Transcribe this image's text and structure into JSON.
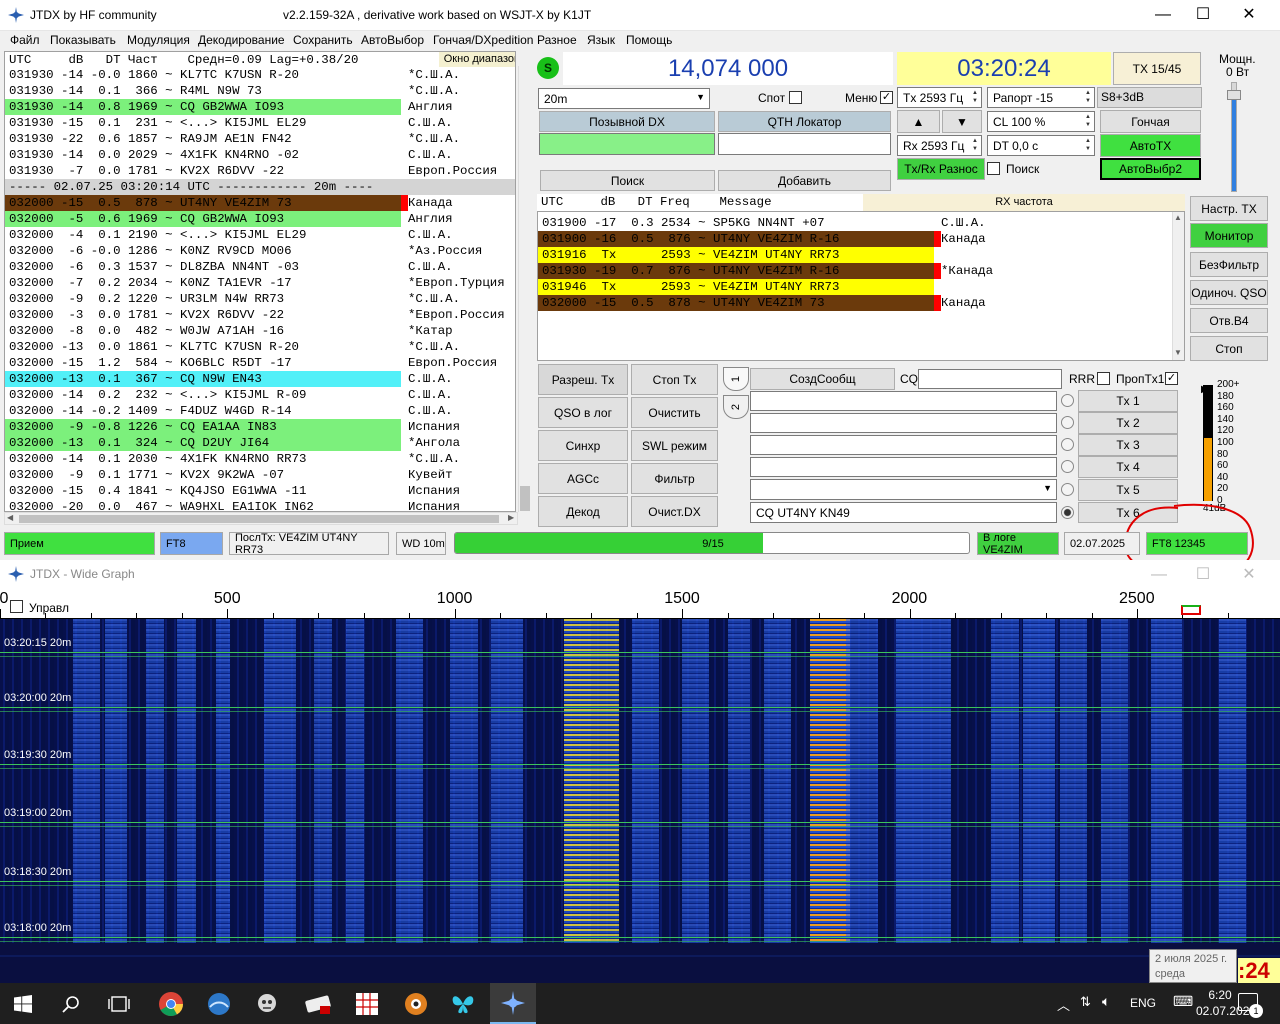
{
  "window": {
    "app_title": "JTDX  by HF community",
    "version_title": "v2.2.159-32A , derivative work based on WSJT-X by K1JT",
    "minimize": "—",
    "maximize": "☐",
    "close": "✕"
  },
  "menu": [
    "Файл",
    "Показывать",
    "Модуляция",
    "Декодирование",
    "Сохранить",
    "АвтоВыбор",
    "Гончая/DXpedition",
    "Разное",
    "Язык",
    "Помощь"
  ],
  "band_activity": {
    "header": "UTC     dB   DT Част    Средн=0.09 Lag=+0.38/20",
    "window_label": "Окно диапазона",
    "lines": [
      {
        "msg": "031930 -14 -0.0 1860 ~ KL7TC K7USN R-20",
        "country": "*С.Ш.А.",
        "style": "none"
      },
      {
        "msg": "031930 -14  0.1  366 ~ R4ML N9W 73",
        "country": "*С.Ш.А.",
        "style": "none"
      },
      {
        "msg": "031930 -14  0.8 1969 ~ CQ GB2WWA IO93",
        "country": "Англия",
        "style": "green"
      },
      {
        "msg": "031930 -15  0.1  231 ~ <...> KI5JML EL29",
        "country": "С.Ш.А.",
        "style": "none"
      },
      {
        "msg": "031930 -22  0.6 1857 ~ RA9JM AE1N FN42",
        "country": "*С.Ш.А.",
        "style": "none"
      },
      {
        "msg": "031930 -14  0.0 2029 ~ 4X1FK KN4RNO -02",
        "country": "С.Ш.А.",
        "style": "none"
      },
      {
        "msg": "031930  -7  0.0 1781 ~ KV2X R6DVV -22",
        "country": "Европ.Россия",
        "style": "none"
      },
      {
        "msg": "----- 02.07.25 03:20:14 UTC ------------ 20m ----",
        "country": "",
        "style": "sep"
      },
      {
        "msg": "032000 -15  0.5  878 ~ UT4NY VE4ZIM 73",
        "country": "Канада",
        "style": "brown"
      },
      {
        "msg": "032000  -5  0.6 1969 ~ CQ GB2WWA IO93",
        "country": "Англия",
        "style": "green"
      },
      {
        "msg": "032000  -4  0.1 2190 ~ <...> KI5JML EL29",
        "country": "С.Ш.А.",
        "style": "none"
      },
      {
        "msg": "032000  -6 -0.0 1286 ~ K0NZ RV9CD MO06",
        "country": "*Аз.Россия",
        "style": "none"
      },
      {
        "msg": "032000  -6  0.3 1537 ~ DL8ZBA NN4NT -03",
        "country": "С.Ш.А.",
        "style": "none"
      },
      {
        "msg": "032000  -7  0.2 2034 ~ K0NZ TA1EVR -17",
        "country": "*Европ.Турция",
        "style": "none"
      },
      {
        "msg": "032000  -9  0.2 1220 ~ UR3LM N4W RR73",
        "country": "*С.Ш.А.",
        "style": "none"
      },
      {
        "msg": "032000  -3  0.0 1781 ~ KV2X R6DVV -22",
        "country": "*Европ.Россия",
        "style": "none"
      },
      {
        "msg": "032000  -8  0.0  482 ~ W0JW A71AH -16",
        "country": "*Катар",
        "style": "none"
      },
      {
        "msg": "032000 -13  0.0 1861 ~ KL7TC K7USN R-20",
        "country": "*С.Ш.А.",
        "style": "none"
      },
      {
        "msg": "032000 -15  1.2  584 ~ KO6BLC R5DT -17",
        "country": "Европ.Россия",
        "style": "none"
      },
      {
        "msg": "032000 -13  0.1  367 ~ CQ N9W EN43",
        "country": "С.Ш.А.",
        "style": "cyan"
      },
      {
        "msg": "032000 -14  0.2  232 ~ <...> KI5JML R-09",
        "country": "С.Ш.А.",
        "style": "none"
      },
      {
        "msg": "032000 -14 -0.2 1409 ~ F4DUZ W4GD R-14",
        "country": "С.Ш.А.",
        "style": "none"
      },
      {
        "msg": "032000  -9 -0.8 1226 ~ CQ EA1AA IN83",
        "country": "Испания",
        "style": "green"
      },
      {
        "msg": "032000 -13  0.1  324 ~ CQ D2UY JI64",
        "country": "*Ангола",
        "style": "green"
      },
      {
        "msg": "032000 -14  0.1 2030 ~ 4X1FK KN4RNO RR73",
        "country": "*С.Ш.А.",
        "style": "none"
      },
      {
        "msg": "032000  -9  0.1 1771 ~ KV2X 9K2WA -07",
        "country": "Кувейт",
        "style": "none"
      },
      {
        "msg": "032000 -15  0.4 1841 ~ KQ4JSO EG1WWA -11",
        "country": "Испания",
        "style": "none"
      },
      {
        "msg": "032000 -20  0.0  467 ~ WA9HXL EA1IOK IN62",
        "country": "Испания",
        "style": "none"
      }
    ]
  },
  "controls": {
    "s_indicator": "S",
    "frequency": "14,074 000",
    "clock": "03:20:24",
    "tx_period": "TX 15/45",
    "band": "20m",
    "spot_label": "Спот",
    "menu_label": "Меню",
    "tx_freq": "Tx  2593  Гц",
    "report": "Рапорт -15",
    "s_meter": "S8+3dB",
    "dx_call_label": "Позывной DX",
    "qth_label": "QTH Локатор",
    "up_arrow": "▲",
    "down_arrow": "▼",
    "cl": "CL  100 %",
    "hound": "Гончая",
    "rx_freq": "Rx  2593  Гц",
    "dt": "DT 0,0 с",
    "auto_tx": "АвтоTX",
    "txrx_split": "Tx/Rx Разнос",
    "search_cb_label": "Поиск",
    "auto_select": "АвтоВыбр2",
    "search_btn": "Поиск",
    "add_btn": "Добавить",
    "power_label": "Мощн.",
    "power_value": "0 Вт"
  },
  "rx_panel": {
    "header": "UTC     dB   DT Freq    Message",
    "rx_freq_label": "RX частота",
    "lines": [
      {
        "msg": "031900 -17  0.3 2534 ~ SP5KG NN4NT +07",
        "country": "С.Ш.А.",
        "style": "none"
      },
      {
        "msg": "031900 -16  0.5  876 ~ UT4NY VE4ZIM R-16",
        "country": "Канада",
        "style": "brown"
      },
      {
        "msg": "031916  Tx      2593 ~ VE4ZIM UT4NY RR73",
        "country": "",
        "style": "yellow"
      },
      {
        "msg": "031930 -19  0.7  876 ~ UT4NY VE4ZIM R-16",
        "country": "*Канада",
        "style": "brown"
      },
      {
        "msg": "031946  Tx      2593 ~ VE4ZIM UT4NY RR73",
        "country": "",
        "style": "yellow"
      },
      {
        "msg": "032000 -15  0.5  878 ~ UT4NY VE4ZIM 73",
        "country": "Канада",
        "style": "brown"
      }
    ]
  },
  "right_buttons": [
    "Настр. TX",
    "Монитор",
    "БезФильтр",
    "Одиноч. QSO",
    "Отв.B4",
    "Стоп"
  ],
  "lower_buttons": [
    "Разреш. Tx",
    "Стоп Tx",
    "QSO в лог",
    "Очистить",
    "Синхр",
    "SWL режим",
    "AGCc",
    "Фильтр",
    "Декод",
    "Очист.DX"
  ],
  "messages": {
    "tab1": "1",
    "tab2": "2",
    "gen_msg": "СоздСообщ",
    "cq_label": "CQ",
    "rrr_label": "RRR",
    "skip_tx1": "ПропTx1",
    "tx_buttons": [
      "Tx 1",
      "Tx 2",
      "Tx 3",
      "Tx 4",
      "Tx 5",
      "Tx 6"
    ],
    "tx6_value": "CQ UT4NY KN49"
  },
  "meter": {
    "ticks": [
      "200+",
      "180",
      "160",
      "140",
      "120",
      "100",
      "80",
      "60",
      "40",
      "20",
      "0"
    ],
    "value_label": "41dB",
    "level_fraction": 0.55
  },
  "statusbar": {
    "mode_rx": "Прием",
    "mode": "FT8",
    "last_tx": "ПослТх: VE4ZIM UT4NY RR73",
    "wd": "WD 10m",
    "progress_text": "9/15",
    "progress_fraction": 0.6,
    "logged": "В логе VE4ZIM",
    "date": "02.07.2025",
    "ft8_code": "FT8  12345"
  },
  "wide_graph": {
    "title": "JTDX - Wide Graph",
    "control_label": "Управл",
    "scale_labels": [
      "0",
      "500",
      "1000",
      "1500",
      "2000",
      "2500"
    ],
    "timestamps": [
      {
        "time": "03:20:15",
        "band": "20m"
      },
      {
        "time": "03:20:00",
        "band": "20m"
      },
      {
        "time": "03:19:30",
        "band": "20m"
      },
      {
        "time": "03:19:00",
        "band": "20m"
      },
      {
        "time": "03:18:30",
        "band": "20m"
      },
      {
        "time": "03:18:00",
        "band": "20m"
      }
    ]
  },
  "tooltip": {
    "line1": "2 июля 2025 г.",
    "line2": "среда"
  },
  "clock_fragment": ":24",
  "taskbar": {
    "lang": "ENG",
    "time": "6:20",
    "date": "02.07.2025",
    "notif_count": "1"
  },
  "colors": {
    "green_hl": "#7cf07c",
    "brown_hl": "#6b3a0c",
    "cyan_hl": "#52f0f8",
    "yellow_hl": "#ffff00",
    "clock_bg": "#ffff99",
    "auto_green": "#40e040",
    "monitor_green": "#40d040",
    "waterfall_bg": "#050b3a",
    "annotation_red": "#e00000"
  }
}
